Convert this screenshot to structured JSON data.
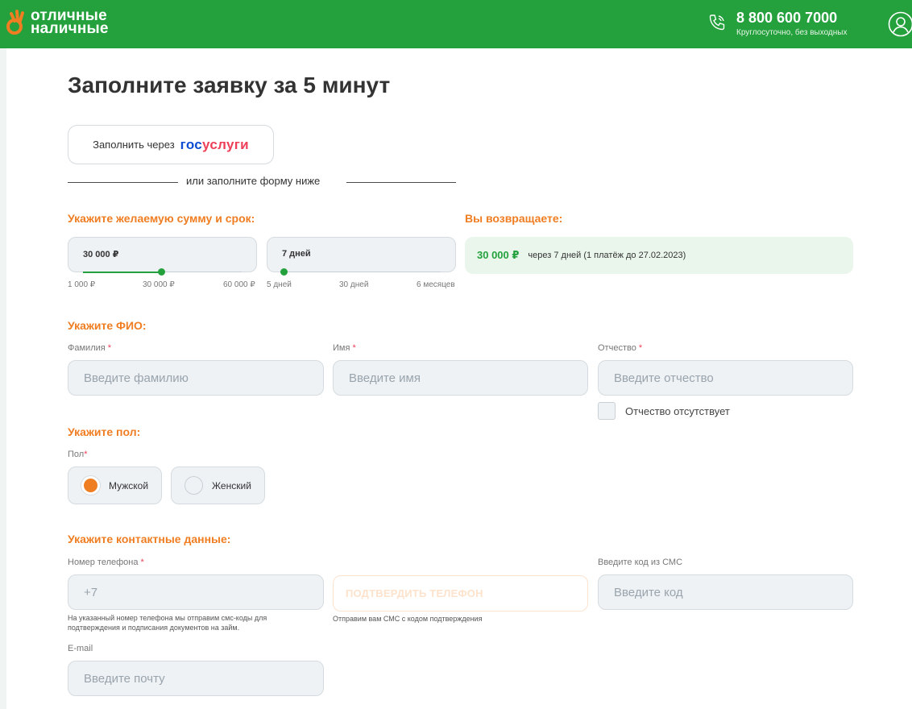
{
  "header": {
    "logo_line1": "отличные",
    "logo_line2": "наличные",
    "phone": "8 800 600 7000",
    "phone_note": "Круглосуточно, без выходных"
  },
  "page_title": "Заполните заявку за 5 минут",
  "gosuslugi": {
    "label": "Заполнить через",
    "logo_part1": "гос",
    "logo_part2": "услуги"
  },
  "divider_text": "или заполните форму ниже",
  "amount_section": {
    "title": "Укажите желаемую сумму и срок:",
    "amount": {
      "value": "30 000 ₽",
      "fraction": 0.49,
      "ticks": [
        "1 000 ₽",
        "30 000 ₽",
        "60 000 ₽"
      ]
    },
    "term": {
      "value": "7 дней",
      "fraction": 0.01,
      "ticks": [
        "5 дней",
        "30 дней",
        "6 месяцев"
      ]
    }
  },
  "return_section": {
    "title": "Вы возвращаете:",
    "amount": "30 000 ₽",
    "note": "через 7 дней (1 платёж до 27.02.2023)"
  },
  "fio_section": {
    "title": "Укажите ФИО:",
    "surname": {
      "label": "Фамилия",
      "placeholder": "Введите фамилию"
    },
    "name": {
      "label": "Имя",
      "placeholder": "Введите имя"
    },
    "patronymic": {
      "label": "Отчество",
      "placeholder": "Введите отчество"
    },
    "no_patronymic": "Отчество отсутствует",
    "required_mark": "*"
  },
  "gender_section": {
    "title": "Укажите пол:",
    "label": "Пол",
    "required_mark": "*",
    "options": [
      "Мужской",
      "Женский"
    ],
    "selected": "Мужской"
  },
  "contact_section": {
    "title": "Укажите контактные данные:",
    "phone": {
      "label": "Номер телефона",
      "required_mark": "*",
      "placeholder": "+7",
      "hint_line1": "На указанный номер телефона мы отправим смс-коды для",
      "hint_line2": "подтверждения и подписания документов на займ."
    },
    "confirm_button": "ПОДТВЕРДИТЬ ТЕЛЕФОН",
    "confirm_hint": "Отправим вам СМС с кодом подтверждения",
    "sms": {
      "label": "Введите код из СМС",
      "placeholder": "Введите код"
    },
    "email": {
      "label": "E-mail",
      "placeholder": "Введите почту"
    }
  },
  "colors": {
    "brand_green": "#24a13c",
    "accent_orange": "#ef7d22",
    "input_bg": "#eef2f5"
  }
}
